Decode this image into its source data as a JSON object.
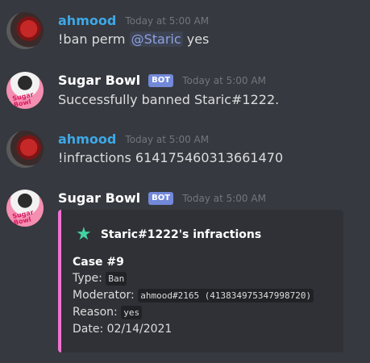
{
  "messages": [
    {
      "username": "ahmood",
      "timestamp": "Today at 5:00 AM",
      "text_prefix": "!ban perm",
      "mention": "@Staric",
      "text_suffix": "yes"
    },
    {
      "username": "Sugar Bowl",
      "badge": "BOT",
      "timestamp": "Today at 5:00 AM",
      "text": "Successfully banned Staric#1222.",
      "avatar_text": "Sugar Bowl"
    },
    {
      "username": "ahmood",
      "timestamp": "Today at 5:00 AM",
      "text": "!infractions 614175460313661470"
    },
    {
      "username": "Sugar Bowl",
      "badge": "BOT",
      "timestamp": "Today at 5:00 AM",
      "avatar_text": "Sugar Bowl",
      "embed": {
        "icon": "star-icon",
        "title": "Staric#1222's infractions",
        "case": "Case #9",
        "type_label": "Type:",
        "type_value": "Ban",
        "moderator_label": "Moderator:",
        "moderator_value": "ahmood#2165 (413834975347998720)",
        "reason_label": "Reason:",
        "reason_value": "yes",
        "date_label": "Date:",
        "date_value": "02/14/2021"
      }
    }
  ],
  "colors": {
    "background": "#36393f",
    "embed_background": "#2f3136",
    "embed_accent": "#f371d2",
    "user_name": "#3ea8e7",
    "bot_badge": "#7289da",
    "star": "#43d3a2"
  }
}
